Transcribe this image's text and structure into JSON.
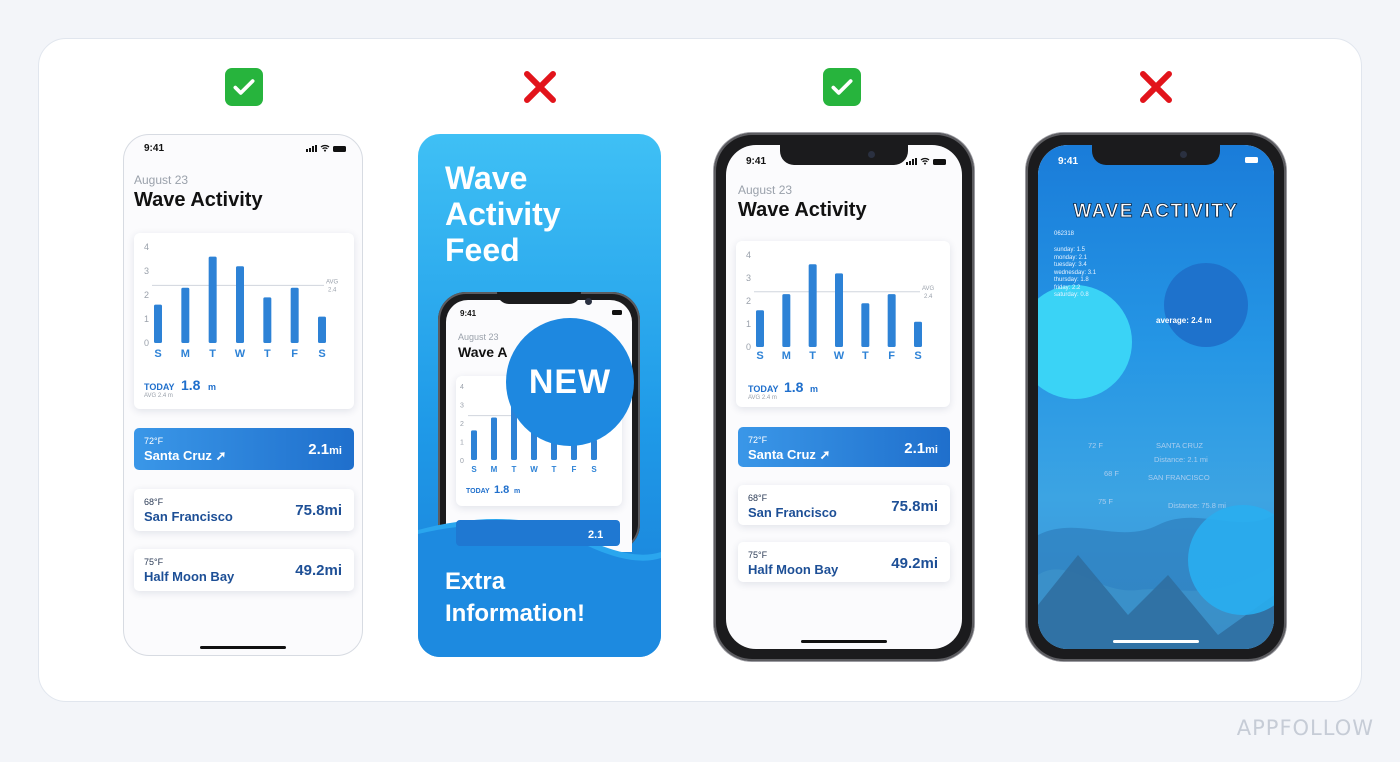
{
  "watermark": "APPFOLLOW",
  "marks": [
    {
      "label": "check-mark",
      "color": "#27b43d"
    },
    {
      "label": "cross-mark",
      "color": "#e2141b"
    },
    {
      "label": "check-mark",
      "color": "#27b43d"
    },
    {
      "label": "cross-mark",
      "color": "#e2141b"
    }
  ],
  "app": {
    "time": "9:41",
    "date": "August 23",
    "title": "Wave Activity",
    "today_label": "TODAY",
    "today_value": "1.8",
    "today_unit": "m",
    "avg_small": "AVG 2.4 m",
    "avg_line_label": "AVG",
    "avg_line_value": "2.4"
  },
  "chart_data": {
    "type": "bar",
    "categories": [
      "S",
      "M",
      "T",
      "W",
      "T",
      "F",
      "S"
    ],
    "values": [
      1.6,
      2.3,
      3.6,
      3.2,
      1.9,
      2.3,
      1.1
    ],
    "y_ticks": [
      "0",
      "1",
      "2",
      "3",
      "4"
    ],
    "ylim": [
      0,
      4
    ],
    "average": 2.4,
    "bar_color": "#2d82d6"
  },
  "locations": [
    {
      "temp": "72°F",
      "name": "Santa Cruz",
      "dist": "2.1",
      "unit": "mi",
      "active": true
    },
    {
      "temp": "68°F",
      "name": "San Francisco",
      "dist": "75.8mi"
    },
    {
      "temp": "75°F",
      "name": "Half Moon Bay",
      "dist": "49.2mi"
    }
  ],
  "promo": {
    "title_lines": [
      "Wave",
      "Activity",
      "Feed"
    ],
    "badge": "NEW",
    "footer_lines": [
      "Extra",
      "Information!"
    ],
    "mini_date": "August 23",
    "mini_title": "Wave A",
    "mini_today_value": "1.8",
    "mini_dist": "2.1"
  },
  "dark_variant": {
    "title": "WAVE ACTIVITY",
    "code": "062318",
    "list": [
      "sunday: 1.5",
      "monday: 2.1",
      "tuesday: 3.4",
      "wednesday: 3.1",
      "thursday: 1.8",
      "friday: 2.2",
      "saturday: 0.8"
    ],
    "average": "average: 2.4 m",
    "ghost_rows": [
      {
        "left": "72 F",
        "right": "SANTA CRUZ"
      },
      {
        "left": "",
        "right": "Distance: 2.1 mi"
      },
      {
        "left": "68 F",
        "right": "SAN FRANCISCO"
      },
      {
        "left": "75 F",
        "right": "Distance: 75.8 mi"
      }
    ]
  }
}
